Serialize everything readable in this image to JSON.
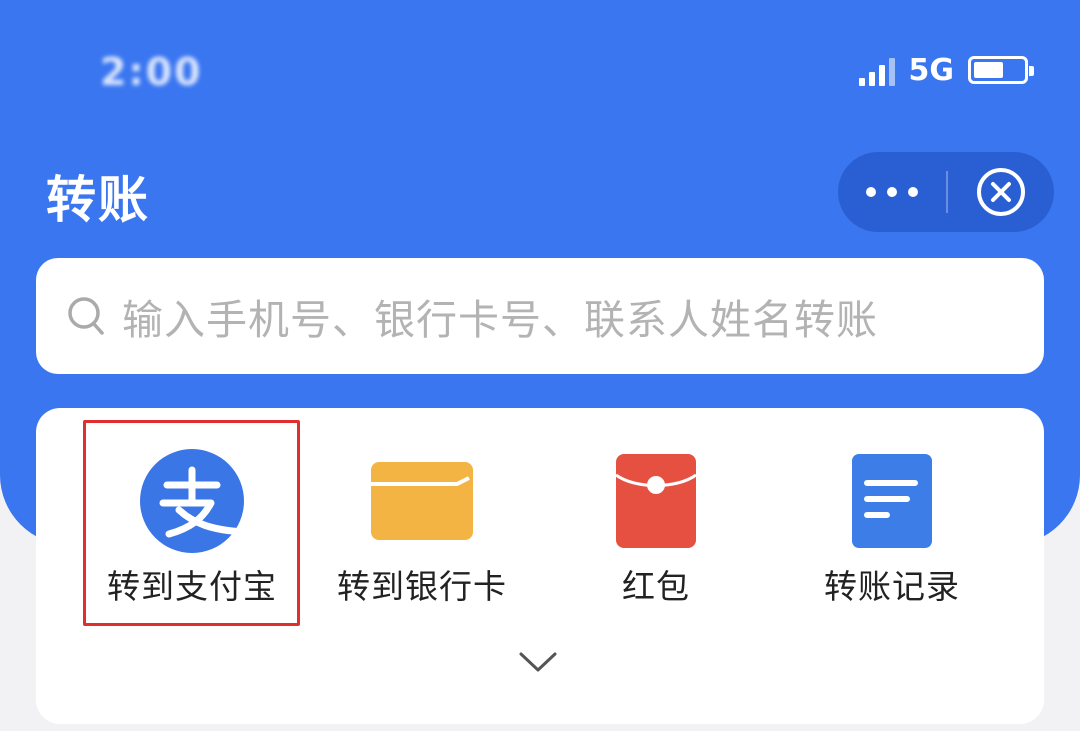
{
  "status_bar": {
    "network": "5G",
    "battery_level": 0.6
  },
  "header": {
    "title": "转账"
  },
  "search": {
    "placeholder": "输入手机号、银行卡号、联系人姓名转账"
  },
  "actions": [
    {
      "label": "转到支付宝",
      "icon": "alipay-icon",
      "highlighted": true
    },
    {
      "label": "转到银行卡",
      "icon": "bank-card-icon"
    },
    {
      "label": "红包",
      "icon": "red-packet-icon"
    },
    {
      "label": "转账记录",
      "icon": "transfer-records-icon"
    }
  ],
  "colors": {
    "brand_blue": "#3a76f0",
    "capsule_blue": "#2a5fd4",
    "alipay_blue": "#3b76e6",
    "bank_card_orange": "#f3b443",
    "red_packet": "#e65040",
    "record_blue": "#3d7de8",
    "highlight_red": "#e0302e"
  }
}
